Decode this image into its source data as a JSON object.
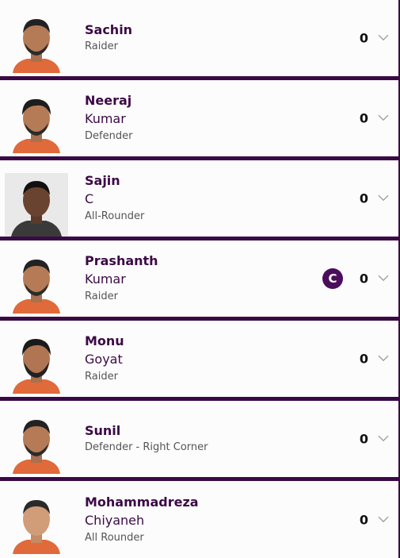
{
  "players": [
    {
      "first": "Sachin",
      "last": "",
      "role": "Raider",
      "points": "0",
      "captain": false,
      "photo_bg": "none",
      "shirt": "#e06a3a"
    },
    {
      "first": "Neeraj",
      "last": "Kumar",
      "role": "Defender",
      "points": "0",
      "captain": false,
      "photo_bg": "none",
      "shirt": "#e06a3a"
    },
    {
      "first": "Sajin",
      "last": "C",
      "role": "All-Rounder",
      "points": "0",
      "captain": false,
      "photo_bg": "grey",
      "shirt": "#3a3a3a"
    },
    {
      "first": "Prashanth",
      "last": "Kumar",
      "role": "Raider",
      "points": "0",
      "captain": true,
      "captain_label": "C",
      "photo_bg": "none",
      "shirt": "#e06a3a"
    },
    {
      "first": "Monu",
      "last": "Goyat",
      "role": "Raider",
      "points": "0",
      "captain": false,
      "photo_bg": "none",
      "shirt": "#e06a3a"
    },
    {
      "first": "Sunil",
      "last": "",
      "role": "Defender - Right Corner",
      "points": "0",
      "captain": false,
      "photo_bg": "none",
      "shirt": "#e06a3a"
    },
    {
      "first": "Mohammadreza",
      "last": "Chiyaneh",
      "role": "All Rounder",
      "points": "0",
      "captain": false,
      "photo_bg": "none",
      "shirt": "#e06a3a"
    }
  ],
  "colors": {
    "name": "#3b0a45",
    "divider": "#3a0a44",
    "captain_badge": "#4b0d5c"
  }
}
